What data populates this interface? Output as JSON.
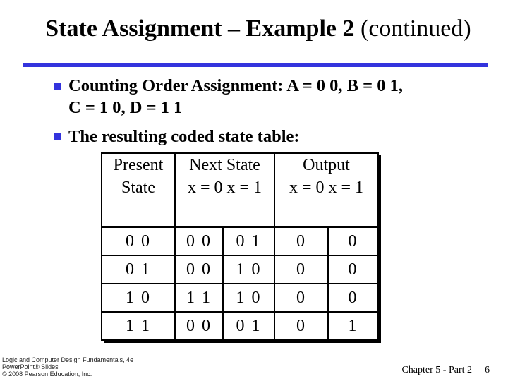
{
  "title": {
    "bold": "State Assignment – Example 2",
    "normal": " (continued)"
  },
  "bullets": [
    {
      "line1": "Counting Order Assignment: A = 0 0, B = 0 1,",
      "line2": "C = 1 0, D = 1 1"
    },
    {
      "line1": "The resulting coded state table:"
    }
  ],
  "table": {
    "header": {
      "present": [
        "Present",
        "State"
      ],
      "next": [
        "Next State",
        "x = 0 x = 1"
      ],
      "output": [
        "Output",
        "x = 0 x = 1"
      ]
    },
    "rows": [
      [
        "0 0",
        "0 0",
        "0 1",
        "0",
        "0"
      ],
      [
        "0 1",
        "0 0",
        "1 0",
        "0",
        "0"
      ],
      [
        "1 0",
        "1 1",
        "1 0",
        "0",
        "0"
      ],
      [
        "1 1",
        "0 0",
        "0 1",
        "0",
        "1"
      ]
    ]
  },
  "footer": {
    "left": [
      "Logic and Computer Design Fundamentals, 4e",
      "PowerPoint® Slides",
      "© 2008 Pearson Education, Inc."
    ],
    "chapter": "Chapter 5 - Part 2",
    "page": "6"
  },
  "colors": {
    "accent": "#3333dd"
  }
}
